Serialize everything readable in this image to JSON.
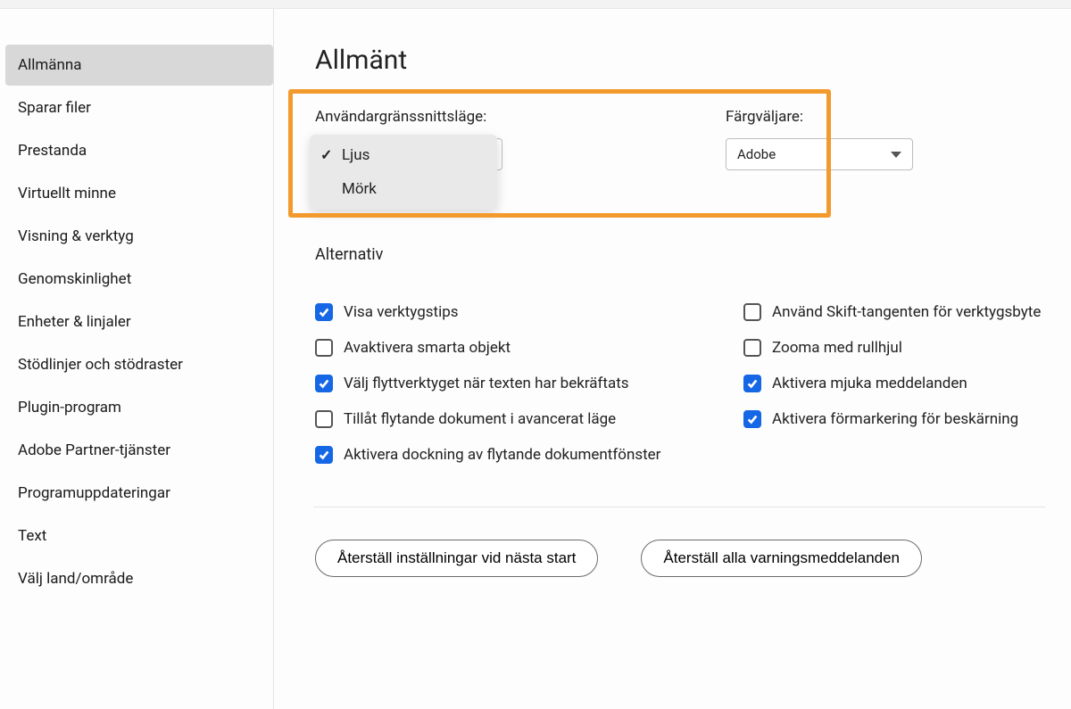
{
  "sidebar": {
    "items": [
      {
        "label": "Allmänna",
        "active": true
      },
      {
        "label": "Sparar filer"
      },
      {
        "label": "Prestanda"
      },
      {
        "label": "Virtuellt minne"
      },
      {
        "label": "Visning & verktyg"
      },
      {
        "label": "Genomskinlighet"
      },
      {
        "label": "Enheter & linjaler"
      },
      {
        "label": "Stödlinjer och stödraster"
      },
      {
        "label": "Plugin-program"
      },
      {
        "label": "Adobe Partner-tjänster"
      },
      {
        "label": "Programuppdateringar"
      },
      {
        "label": "Text"
      },
      {
        "label": "Välj land/område"
      }
    ]
  },
  "main": {
    "title": "Allmänt",
    "uiMode": {
      "label": "Användargränssnittsläge:",
      "options": [
        "Ljus",
        "Mörk"
      ],
      "selected": "Ljus"
    },
    "colorPicker": {
      "label": "Färgväljare:",
      "value": "Adobe"
    },
    "altHeading": "Alternativ",
    "opts": {
      "left": [
        {
          "label": "Visa verktygstips",
          "checked": true
        },
        {
          "label": "Avaktivera smarta objekt",
          "checked": false
        },
        {
          "label": "Välj flyttverktyget när texten har bekräftats",
          "checked": true
        },
        {
          "label": "Tillåt flytande dokument i avancerat läge",
          "checked": false
        },
        {
          "label": "Aktivera dockning av flytande dokumentfönster",
          "checked": true
        }
      ],
      "right": [
        {
          "label": "Använd Skift-tangenten för verktygsbyte",
          "checked": false
        },
        {
          "label": "Zooma med rullhjul",
          "checked": false
        },
        {
          "label": "Aktivera mjuka meddelanden",
          "checked": true
        },
        {
          "label": "Aktivera förmarkering för beskärning",
          "checked": true
        }
      ]
    },
    "buttons": {
      "reset": "Återställ inställningar vid nästa start",
      "resetWarnings": "Återställ alla varningsmeddelanden"
    }
  }
}
